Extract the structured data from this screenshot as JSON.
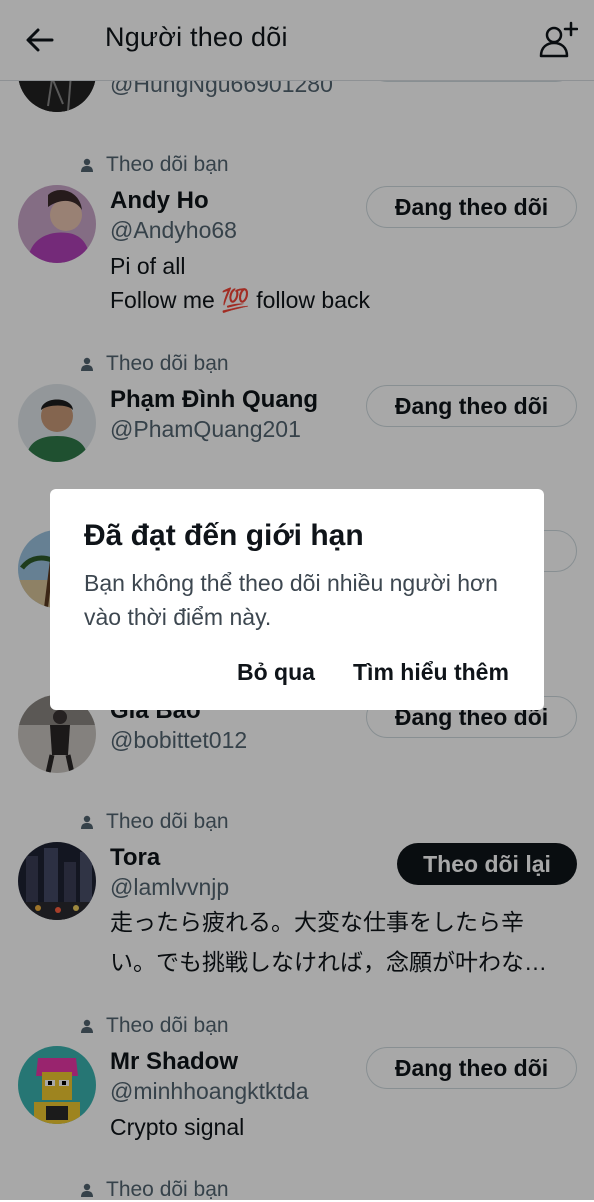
{
  "header": {
    "title": "Người theo dõi",
    "back_icon": "arrow-left-icon",
    "add_icon": "add-user-icon"
  },
  "followers": [
    {
      "follows_you": "",
      "name": "",
      "handle": "@HungNgu66901280",
      "bio": [],
      "button": ""
    },
    {
      "follows_you": "Theo dõi bạn",
      "name": "Andy Ho",
      "handle": "@Andyho68",
      "bio": [
        "Pi of all",
        "Follow me 💯 follow back"
      ],
      "button": "Đang theo dõi"
    },
    {
      "follows_you": "Theo dõi bạn",
      "name": "Phạm Đình Quang",
      "handle": "@PhamQuang201",
      "bio": [],
      "button": "Đang theo dõi"
    },
    {
      "follows_you": "",
      "name": "",
      "handle": "",
      "bio": [],
      "button": ""
    },
    {
      "follows_you": "",
      "name": "Gia Bảo",
      "handle": "@bobittet012",
      "bio": [],
      "button": "Đang theo dõi"
    },
    {
      "follows_you": "Theo dõi bạn",
      "name": "Tora",
      "handle": "@lamlvvnjp",
      "bio": [
        "走ったら疲れる。大変な仕事をしたら辛",
        "い。でも挑戦しなければ，念願が叶わな…"
      ],
      "button": "Theo dõi lại"
    },
    {
      "follows_you": "Theo dõi bạn",
      "name": "Mr Shadow",
      "handle": "@minhhoangktktda",
      "bio": [
        "Crypto signal"
      ],
      "button": "Đang theo dõi"
    },
    {
      "follows_you": "Theo dõi bạn",
      "name": "",
      "handle": "",
      "bio": [],
      "button": ""
    }
  ],
  "dialog": {
    "title": "Đã đạt đến giới hạn",
    "body": "Bạn không thể theo dõi nhiều người hơn vào thời điểm này.",
    "dismiss_label": "Bỏ qua",
    "learn_more_label": "Tìm hiểu thêm"
  },
  "colors": {
    "text": "#0f1419",
    "secondary": "#536471",
    "overlay": "rgba(0,0,0,0.34)"
  }
}
